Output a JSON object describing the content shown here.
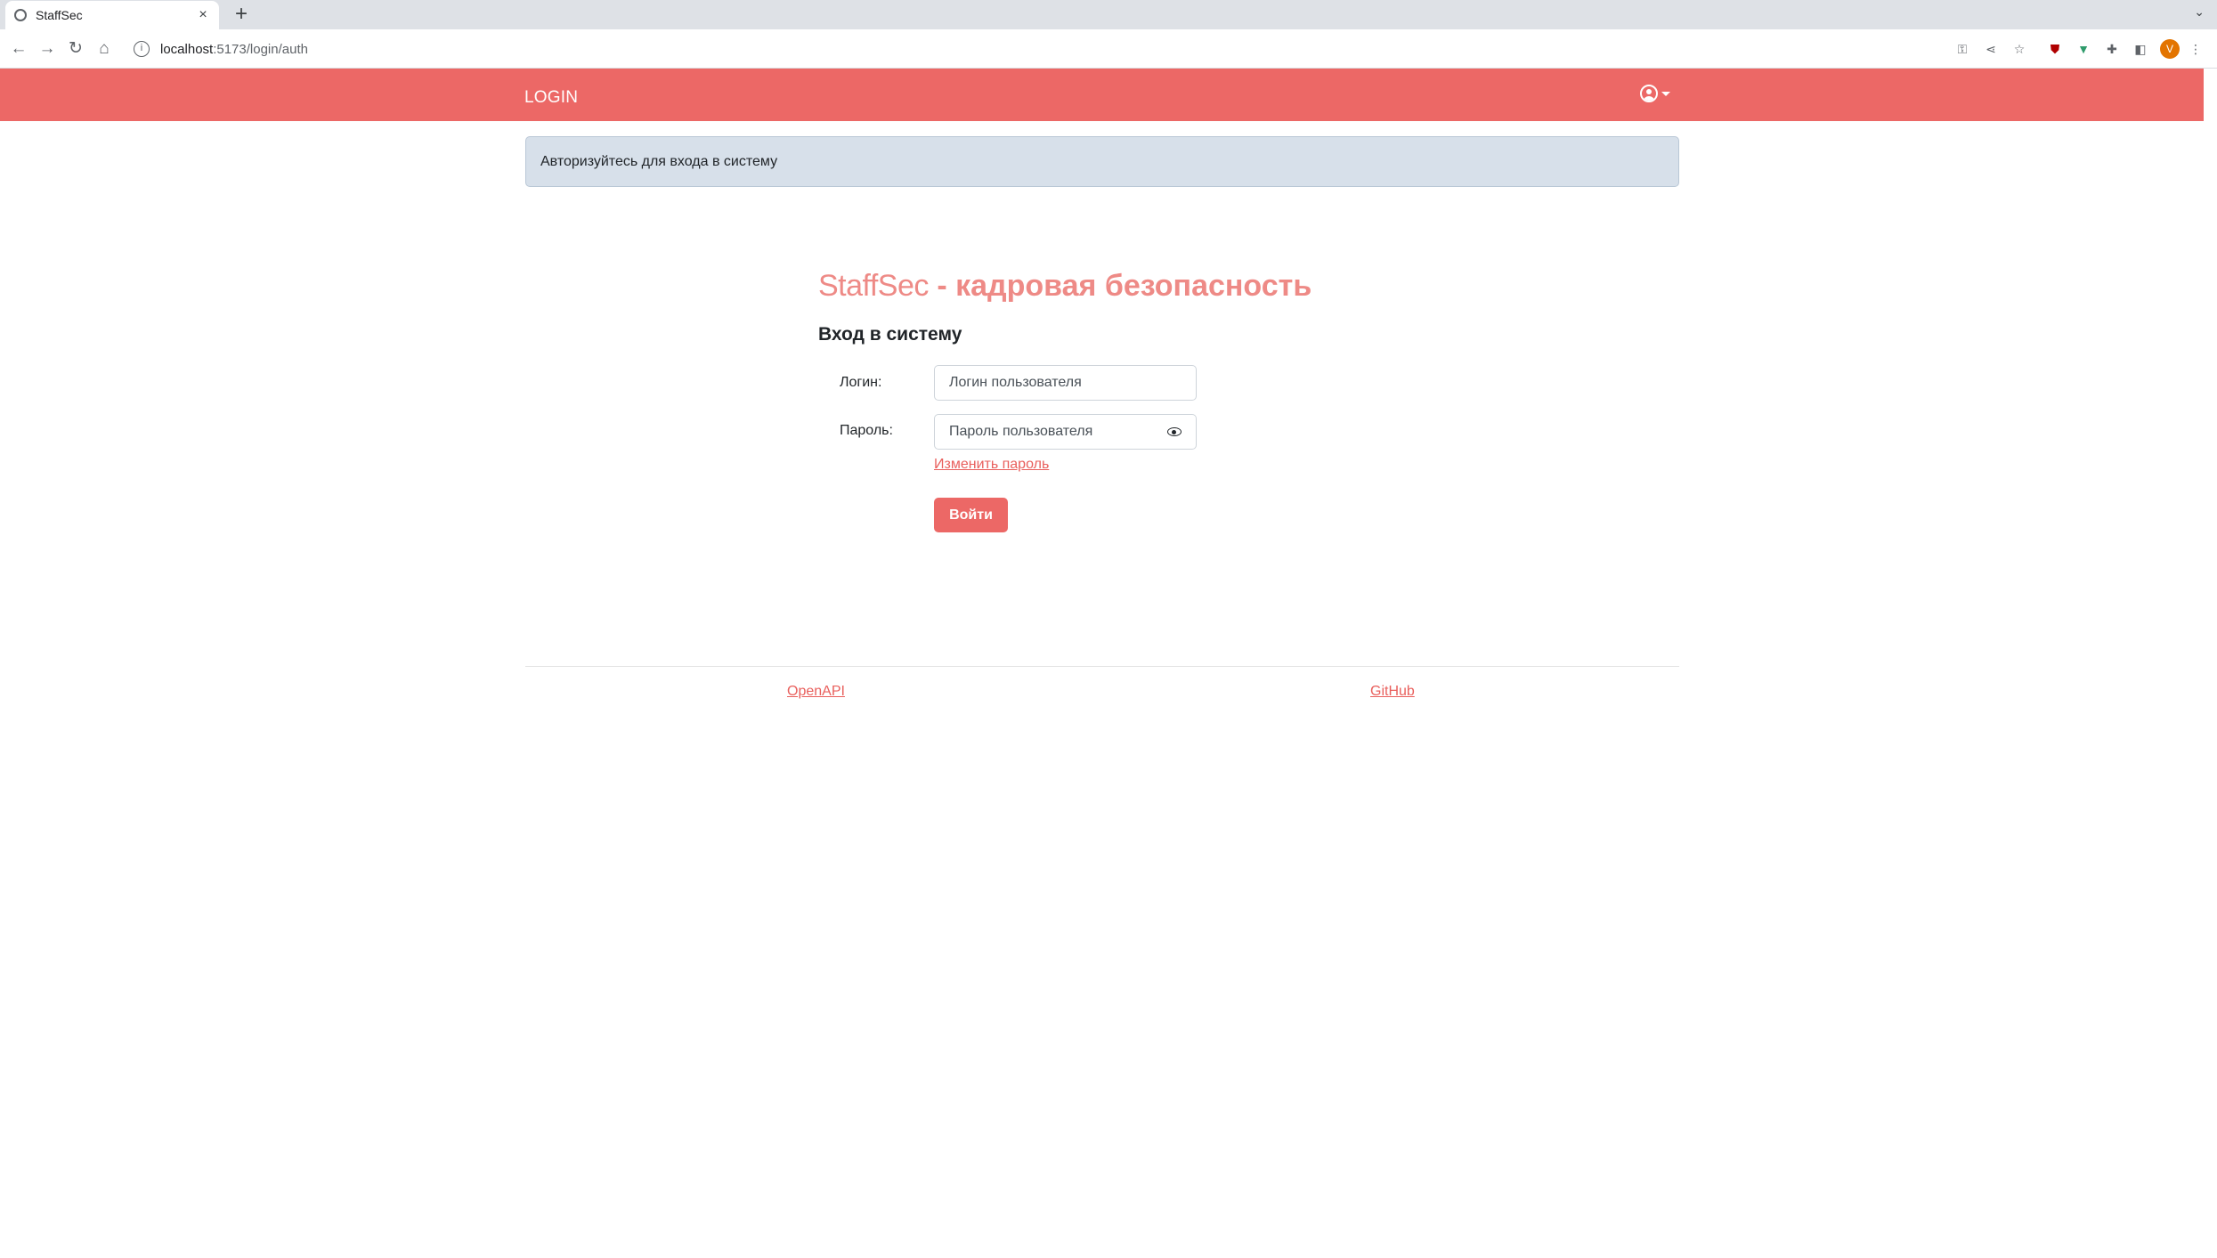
{
  "browser": {
    "tab_title": "StaffSec",
    "tab_close": "×",
    "new_tab": "+",
    "tab_menu": "⌄",
    "url_host": "localhost",
    "url_path": ":5173/login/auth",
    "profile_initial": "V"
  },
  "navbar": {
    "brand": "LOGIN",
    "color": "#ec6866"
  },
  "alert": {
    "text": "Авторизуйтесь для входа в систему"
  },
  "login": {
    "title_brand": "StaffSec",
    "title_rest": " - кадровая безопасность",
    "form_title": "Вход в систему",
    "login_label": "Логин:",
    "login_placeholder": "Логин пользователя",
    "password_label": "Пароль:",
    "password_placeholder": "Пароль пользователя",
    "change_password": "Изменить пароль",
    "submit": "Войти"
  },
  "footer": {
    "openapi": "OpenAPI",
    "github": "GitHub"
  },
  "colors": {
    "accent": "#ec6866",
    "title": "#ee8a86",
    "link": "#e9605d",
    "alert_bg": "#d7e0ea"
  },
  "icons": [
    "globe-icon",
    "back-icon",
    "forward-icon",
    "reload-icon",
    "home-icon",
    "info-icon",
    "key-icon",
    "share-icon",
    "star-icon",
    "ublock-icon",
    "vue-devtools-icon",
    "extensions-icon",
    "side-panel-icon",
    "menu-icon",
    "user-circle-icon",
    "eye-icon"
  ]
}
